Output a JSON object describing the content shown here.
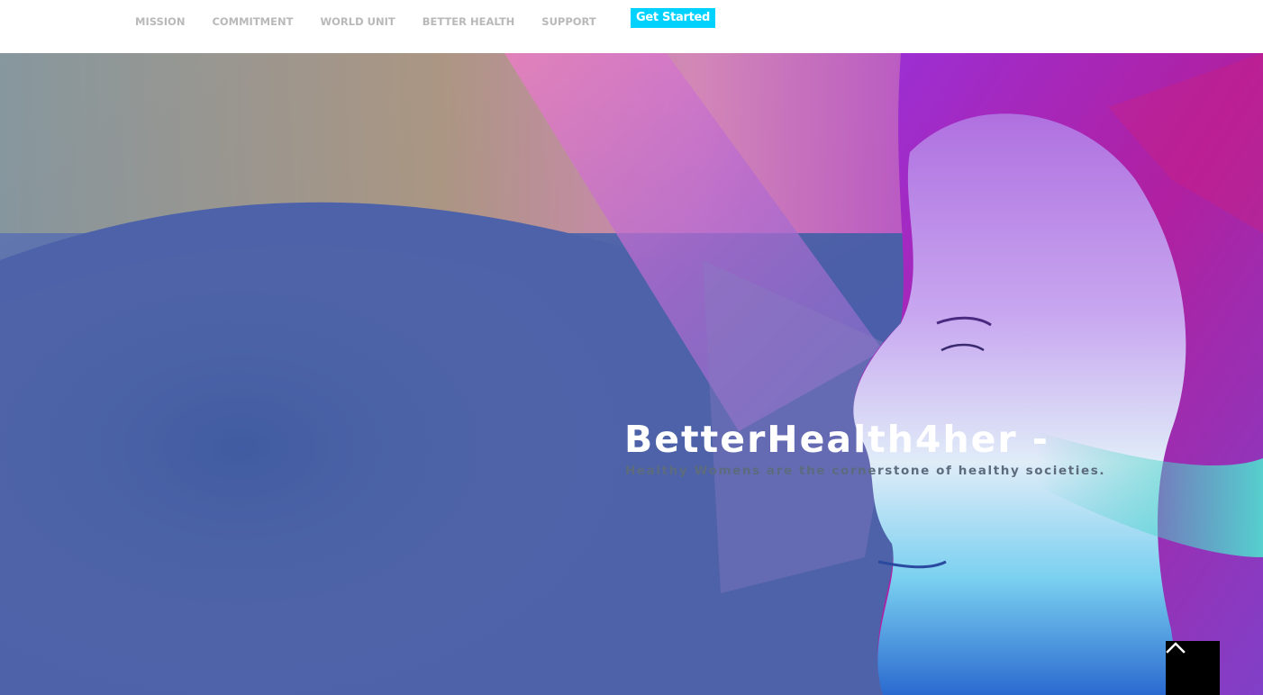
{
  "nav": {
    "items": [
      {
        "label": "MISSION"
      },
      {
        "label": "COMMITMENT"
      },
      {
        "label": "WORLD UNIT"
      },
      {
        "label": "BETTER HEALTH"
      },
      {
        "label": "SUPPORT"
      }
    ],
    "cta_label": "Get Started"
  },
  "hero": {
    "title": "BetterHealth4her -",
    "subtitle": "Healthy Womens are the cornerstone of healthy societies."
  },
  "back_to_top": {
    "icon": "chevron-up-icon"
  },
  "colors": {
    "cta_background": "#00d2ff",
    "nav_text": "#b9b9b9",
    "hero_base": "#4a5fa6",
    "back_to_top_background": "#000000"
  }
}
